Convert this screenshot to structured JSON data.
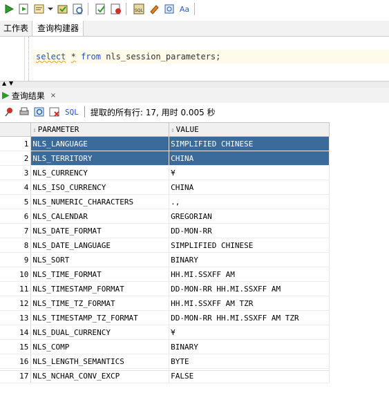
{
  "toolbar": {
    "icons": [
      "run-icon",
      "run-script-icon",
      "explain-plan-icon",
      "dropdown-arrow-icon",
      "commit-icon",
      "rollback-icon",
      "check-icon",
      "cancel-icon",
      "sql-tuning-icon",
      "eraser-icon",
      "history-icon",
      "text-case-icon"
    ],
    "text_case_glyph": "Aa"
  },
  "worksheet_tabs": [
    "工作表",
    "查询构建器"
  ],
  "editor": {
    "sql": {
      "select": "select",
      "star": "*",
      "from": "from",
      "table": "nls_session_parameters",
      "semicolon": ";"
    }
  },
  "results": {
    "tab_label": "查询结果",
    "close": "×",
    "sql_label": "SQL",
    "fetch_status": "提取的所有行: 17, 用时 0.005 秒",
    "columns": [
      "PARAMETER",
      "VALUE"
    ],
    "rows": [
      {
        "n": "1",
        "param": "NLS_LANGUAGE",
        "value": "SIMPLIFIED CHINESE",
        "selected": true
      },
      {
        "n": "2",
        "param": "NLS_TERRITORY",
        "value": "CHINA",
        "selected": true
      },
      {
        "n": "3",
        "param": "NLS_CURRENCY",
        "value": "¥",
        "selected": false
      },
      {
        "n": "4",
        "param": "NLS_ISO_CURRENCY",
        "value": "CHINA",
        "selected": false
      },
      {
        "n": "5",
        "param": "NLS_NUMERIC_CHARACTERS",
        "value": ".,",
        "selected": false
      },
      {
        "n": "6",
        "param": "NLS_CALENDAR",
        "value": "GREGORIAN",
        "selected": false
      },
      {
        "n": "7",
        "param": "NLS_DATE_FORMAT",
        "value": "DD-MON-RR",
        "selected": false
      },
      {
        "n": "8",
        "param": "NLS_DATE_LANGUAGE",
        "value": "SIMPLIFIED CHINESE",
        "selected": false
      },
      {
        "n": "9",
        "param": "NLS_SORT",
        "value": "BINARY",
        "selected": false
      },
      {
        "n": "10",
        "param": "NLS_TIME_FORMAT",
        "value": "HH.MI.SSXFF AM",
        "selected": false
      },
      {
        "n": "11",
        "param": "NLS_TIMESTAMP_FORMAT",
        "value": "DD-MON-RR HH.MI.SSXFF AM",
        "selected": false
      },
      {
        "n": "12",
        "param": "NLS_TIME_TZ_FORMAT",
        "value": "HH.MI.SSXFF AM TZR",
        "selected": false
      },
      {
        "n": "13",
        "param": "NLS_TIMESTAMP_TZ_FORMAT",
        "value": "DD-MON-RR HH.MI.SSXFF AM TZR",
        "selected": false
      },
      {
        "n": "14",
        "param": "NLS_DUAL_CURRENCY",
        "value": "¥",
        "selected": false
      },
      {
        "n": "15",
        "param": "NLS_COMP",
        "value": "BINARY",
        "selected": false
      },
      {
        "n": "16",
        "param": "NLS_LENGTH_SEMANTICS",
        "value": "BYTE",
        "selected": false
      },
      {
        "n": "17",
        "param": "NLS_NCHAR_CONV_EXCP",
        "value": "FALSE",
        "selected": false
      }
    ]
  },
  "colors": {
    "selection": "#3a6b9b",
    "keyword": "#1f4fd1",
    "run_green": "#2f9b2f"
  }
}
